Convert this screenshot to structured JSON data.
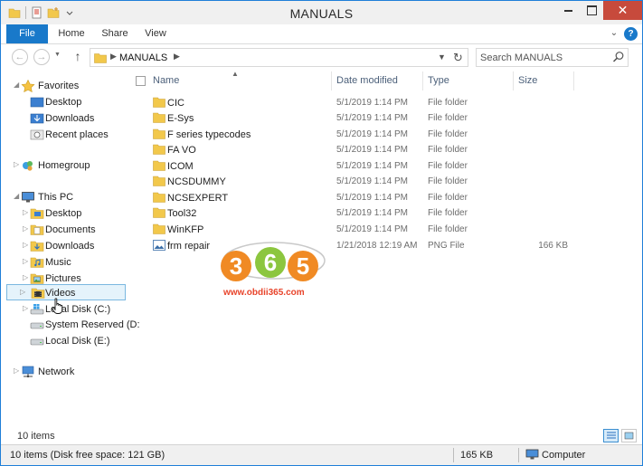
{
  "window": {
    "title": "MANUALS",
    "close_glyph": "✕"
  },
  "ribbon": {
    "tabs": [
      "File",
      "Home",
      "Share",
      "View"
    ],
    "help_glyph": "?",
    "expand_glyph": "⌄"
  },
  "address": {
    "crumb": "MANUALS",
    "search_placeholder": "Search MANUALS"
  },
  "nav_pane": {
    "items": [
      {
        "label": "Favorites",
        "icon": "star-icon"
      },
      {
        "label": "Desktop",
        "icon": "desktop-icon"
      },
      {
        "label": "Downloads",
        "icon": "downloads-icon"
      },
      {
        "label": "Recent places",
        "icon": "recent-places-icon"
      },
      {
        "label": "Homegroup",
        "icon": "homegroup-icon"
      },
      {
        "label": "This PC",
        "icon": "computer-icon"
      },
      {
        "label": "Desktop",
        "icon": "desktop-folder-icon"
      },
      {
        "label": "Documents",
        "icon": "documents-folder-icon"
      },
      {
        "label": "Downloads",
        "icon": "downloads-folder-icon"
      },
      {
        "label": "Music",
        "icon": "music-folder-icon"
      },
      {
        "label": "Pictures",
        "icon": "pictures-folder-icon"
      },
      {
        "label": "Videos",
        "icon": "videos-folder-icon"
      },
      {
        "label": "Local Disk (C:)",
        "icon": "windows-drive-icon"
      },
      {
        "label": "System Reserved (D:",
        "icon": "drive-icon"
      },
      {
        "label": "Local Disk (E:)",
        "icon": "drive-icon"
      },
      {
        "label": "Network",
        "icon": "network-icon"
      }
    ]
  },
  "columns": {
    "name": "Name",
    "date": "Date modified",
    "type": "Type",
    "size": "Size"
  },
  "files": [
    {
      "name": "CIC",
      "date": "5/1/2019 1:14 PM",
      "type": "File folder",
      "size": "",
      "icon": "folder-icon"
    },
    {
      "name": "E-Sys",
      "date": "5/1/2019 1:14 PM",
      "type": "File folder",
      "size": "",
      "icon": "folder-icon"
    },
    {
      "name": "F series typecodes",
      "date": "5/1/2019 1:14 PM",
      "type": "File folder",
      "size": "",
      "icon": "folder-icon"
    },
    {
      "name": "FA VO",
      "date": "5/1/2019 1:14 PM",
      "type": "File folder",
      "size": "",
      "icon": "folder-icon"
    },
    {
      "name": "ICOM",
      "date": "5/1/2019 1:14 PM",
      "type": "File folder",
      "size": "",
      "icon": "folder-icon"
    },
    {
      "name": "NCSDUMMY",
      "date": "5/1/2019 1:14 PM",
      "type": "File folder",
      "size": "",
      "icon": "folder-icon"
    },
    {
      "name": "NCSEXPERT",
      "date": "5/1/2019 1:14 PM",
      "type": "File folder",
      "size": "",
      "icon": "folder-icon"
    },
    {
      "name": "Tool32",
      "date": "5/1/2019 1:14 PM",
      "type": "File folder",
      "size": "",
      "icon": "folder-icon"
    },
    {
      "name": "WinKFP",
      "date": "5/1/2019 1:14 PM",
      "type": "File folder",
      "size": "",
      "icon": "folder-icon"
    },
    {
      "name": "frm repair",
      "date": "1/21/2018 12:19 AM",
      "type": "PNG File",
      "size": "166 KB",
      "icon": "image-file-icon"
    }
  ],
  "watermark": {
    "digits": [
      "3",
      "6",
      "5"
    ],
    "url": "www.obdii365.com"
  },
  "status": {
    "item_count": "10 items",
    "summary": "10 items (Disk free space: 121 GB)",
    "selected_size": "165 KB",
    "location": "Computer"
  },
  "colors": {
    "accent": "#1979ca",
    "close": "#c74a3c",
    "folder": "#f2c84b",
    "watermark_orange": "#e8442b"
  }
}
